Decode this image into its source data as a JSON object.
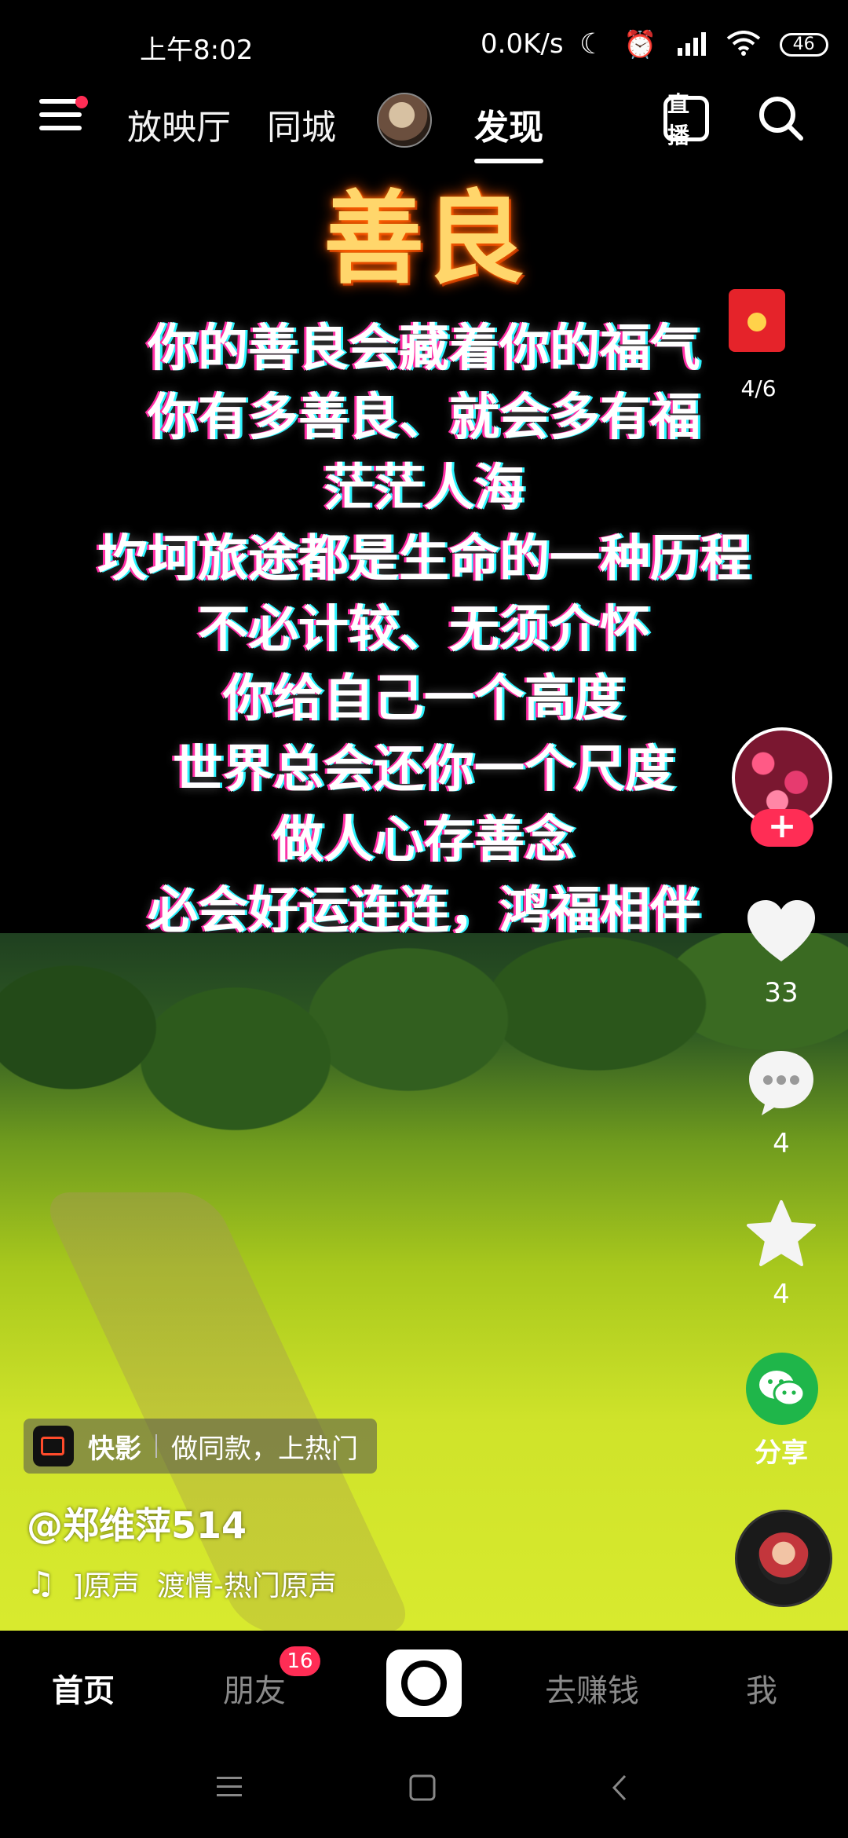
{
  "status_bar": {
    "time": "上午8:02",
    "net_speed": "0.0K/s",
    "battery": "46",
    "icons": [
      "moon-icon",
      "alarm-icon",
      "signal-icon",
      "wifi-icon",
      "battery-icon"
    ]
  },
  "top_nav": {
    "tabs": [
      "放映厅",
      "同城",
      "发现"
    ],
    "active_tab": "发现",
    "live_label": "直播",
    "icons": [
      "menu-icon",
      "live-icon",
      "search-icon"
    ]
  },
  "poem": {
    "title": "善良",
    "lines": [
      "你的善良会藏着你的福气",
      "你有多善良、就会多有福",
      "茫茫人海",
      "坎坷旅途都是生命的一种历程",
      "不必计较、无须介怀",
      "你给自己一个高度",
      "世界总会还你一个尺度",
      "做人心存善念",
      "必会好运连连，鸿福相伴"
    ]
  },
  "right_rail": {
    "redpacket_count": "4/6",
    "follow_label": "+",
    "likes": "33",
    "comments": "4",
    "favorites": "4",
    "share_label": "分享",
    "icons": [
      "red-packet-icon",
      "heart-icon",
      "comment-icon",
      "star-icon",
      "wechat-share-icon",
      "music-disc-icon"
    ]
  },
  "caption": {
    "promo_brand": "快影",
    "promo_text": "做同款，上热门",
    "username": "@郑维萍514",
    "music_prefix": "]原声",
    "music_title": "渡情-热门原声"
  },
  "tab_bar": {
    "tabs": [
      "首页",
      "朋友",
      "去赚钱",
      "我"
    ],
    "active": "首页",
    "friends_badge": "16"
  },
  "colors": {
    "accent": "#ff2d55",
    "title_glow": "#ff6a00",
    "share_green": "#1fb64a"
  }
}
